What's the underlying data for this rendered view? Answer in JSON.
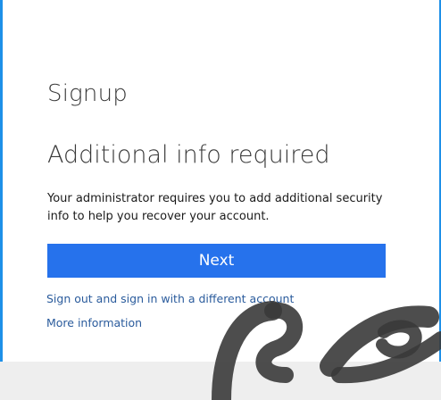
{
  "page": {
    "title": "Signup",
    "heading": "Additional info required",
    "description": "Your administrator requires you to add additional security info to help you recover your account."
  },
  "actions": {
    "next_label": "Next",
    "sign_out_link": "Sign out and sign in with a different account",
    "more_info_link": "More information"
  },
  "colors": {
    "accent": "#2672ec",
    "edge": "#1e90e8",
    "link": "#2a5b9c"
  }
}
